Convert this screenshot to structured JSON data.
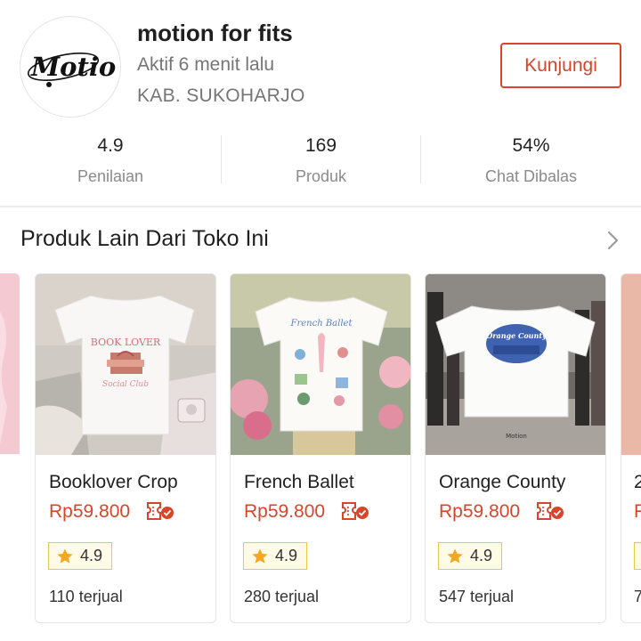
{
  "shop": {
    "name": "motion for fits",
    "active_status": "Aktif 6 menit lalu",
    "location": "KAB. SUKOHARJO",
    "visit_label": "Kunjungi",
    "logo_text": "Motion"
  },
  "stats": [
    {
      "value": "4.9",
      "label": "Penilaian"
    },
    {
      "value": "169",
      "label": "Produk"
    },
    {
      "value": "54%",
      "label": "Chat Dibalas"
    }
  ],
  "section": {
    "title": "Produk Lain Dari Toko Ini"
  },
  "products": [
    {
      "title": "Booklover Crop",
      "price": "Rp59.800",
      "rating": "4.9",
      "sold": "110 terjual",
      "print_text": "BOOK LOVER"
    },
    {
      "title": "French Ballet",
      "price": "Rp59.800",
      "rating": "4.9",
      "sold": "280 terjual",
      "print_text": "French Ballet"
    },
    {
      "title": "Orange County",
      "price": "Rp59.800",
      "rating": "4.9",
      "sold": "547 terjual",
      "print_text": "Orange County"
    }
  ],
  "peek_right": {
    "title_partial": "2",
    "price_partial": "F",
    "sold_partial": "7"
  },
  "colors": {
    "accent": "#d8452b",
    "rating_border": "#e9c84a",
    "star": "#f5a623"
  }
}
